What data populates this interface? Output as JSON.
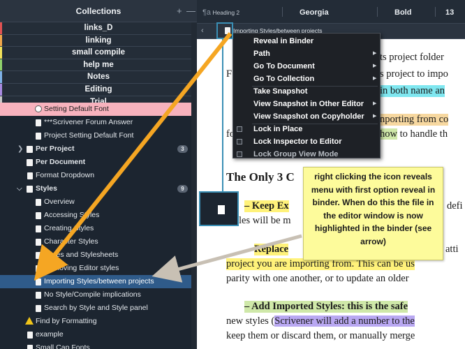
{
  "binder": {
    "title": "Collections",
    "add": "+",
    "remove": "—",
    "collections": [
      {
        "label": "links_D",
        "color": "#e05252"
      },
      {
        "label": "linking",
        "color": "#f0a64a"
      },
      {
        "label": "small compile",
        "color": "#f1e15a"
      },
      {
        "label": "help me",
        "color": "#8fd16b"
      },
      {
        "label": "Notes",
        "color": "#7fb1e6"
      },
      {
        "label": "Editing",
        "color": "#a98ae0"
      },
      {
        "label": "Trial",
        "color": "#c7c7c7"
      }
    ],
    "tree": [
      {
        "label": "Setting Default Font"
      },
      {
        "label": "***Scrivener Forum Answer"
      },
      {
        "label": "Project Setting Default Font"
      },
      {
        "label": "Per Project",
        "badge": "3"
      },
      {
        "label": "Per Document"
      },
      {
        "label": "Format Dropdown"
      },
      {
        "label": "Styles",
        "badge": "9"
      },
      {
        "label": "Overview"
      },
      {
        "label": "Accessing Styles"
      },
      {
        "label": "Creating Styles"
      },
      {
        "label": "Character Styles"
      },
      {
        "label": "Styles and Stylesheets"
      },
      {
        "label": "Removing Editor styles"
      },
      {
        "label": "Importing Styles/between projects"
      },
      {
        "label": "No Style/Compile implications"
      },
      {
        "label": "Search by Style and Style panel"
      },
      {
        "label": "Find by Formatting"
      },
      {
        "label": "example"
      },
      {
        "label": "Small Cap Fonts"
      }
    ]
  },
  "format_bar": {
    "style": "Heading 2",
    "font": "Georgia",
    "weight": "Bold",
    "size": "13"
  },
  "header_bar": {
    "title": "Importing Styles/between projects"
  },
  "editor_text": {
    "line1": "ts project folder",
    "line2": "s project to impo",
    "line3": "in both name an",
    "line4": "nporting from co",
    "line5a": "how",
    "line5b": " to handle th",
    "heading": "The Only 3 C",
    "keep": "– Keep Ex",
    "keep_tail": "defi",
    "les": "les will be m",
    "replace": "Replace",
    "replace_tail": "atti",
    "project_line": "project you are importing from. This can be us",
    "parity_line": "parity with one another, or to update an older",
    "add_line": "– Add Imported Styles: this is the safe",
    "new_styles_a": "new styles (",
    "new_styles_b": "Scrivener will add a number to the",
    "keep_them": "keep them or discard them, or manually merge"
  },
  "context_menu": {
    "items": [
      {
        "label": "Reveal in Binder"
      },
      {
        "label": "Path",
        "submenu": true
      },
      {
        "label": "Go To Document",
        "submenu": true
      },
      {
        "label": "Go To Collection",
        "submenu": true
      },
      {
        "label": "Take Snapshot"
      },
      {
        "label": "View Snapshot in Other Editor",
        "submenu": true
      },
      {
        "label": "View Snapshot on Copyholder",
        "submenu": true
      },
      {
        "label": "Lock in Place",
        "check": true
      },
      {
        "label": "Lock Inspector to Editor",
        "check": true
      },
      {
        "label": "Lock Group View Mode",
        "check": true
      }
    ]
  },
  "note": {
    "text": "right clicking the icon reveals menu with first option reveal in binder. When do this the file in the editor window is now highlighted in the binder (see arrow)"
  },
  "colors": {
    "arrow_orange": "#f5a623",
    "arrow_gray": "#c8c0b4",
    "selection": "#2f5b8a",
    "highlight_pink": "#f7b2bd"
  }
}
